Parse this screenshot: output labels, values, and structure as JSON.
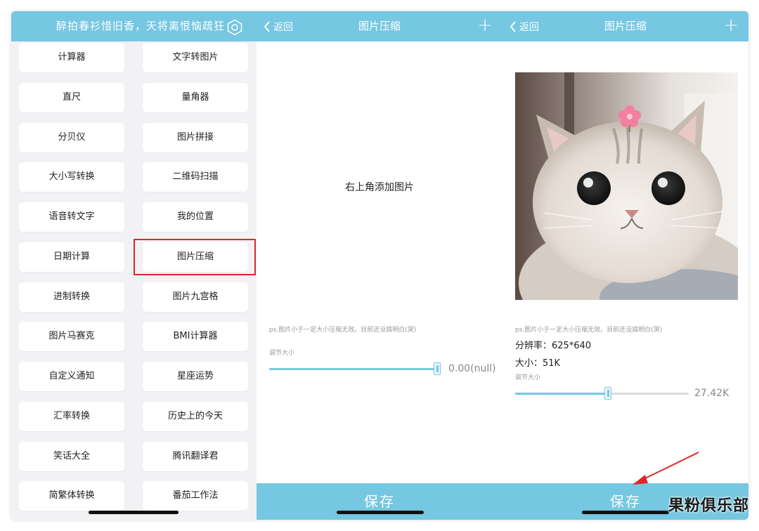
{
  "panel1": {
    "header_title": "醉拍春衫惜旧香，天将离恨恼疏狂",
    "settings_icon": "hexagon-settings-icon",
    "tools": [
      [
        "计算器",
        "文字转图片"
      ],
      [
        "直尺",
        "量角器"
      ],
      [
        "分贝仪",
        "图片拼接"
      ],
      [
        "大小写转换",
        "二维码扫描"
      ],
      [
        "语音转文字",
        "我的位置"
      ],
      [
        "日期计算",
        "图片压缩"
      ],
      [
        "进制转换",
        "图片九宫格"
      ],
      [
        "图片马赛克",
        "BMI计算器"
      ],
      [
        "自定义通知",
        "星座运势"
      ],
      [
        "汇率转换",
        "历史上的今天"
      ],
      [
        "笑话大全",
        "腾讯翻译君"
      ],
      [
        "简繁体转换",
        "番茄工作法"
      ]
    ],
    "highlighted_tool": "图片压缩",
    "highlight_color": "#e0262b"
  },
  "panel2": {
    "back_label": "返回",
    "title": "图片压缩",
    "plus_label": "+",
    "empty_hint": "右上角添加图片",
    "note": "ps.图片小于一定大小压缩无效。目前还没搞明白(哭)",
    "slider_label": "调节大小",
    "slider_value": "0.00(null)",
    "slider_level": 1.0,
    "save_label": "保存"
  },
  "panel3": {
    "back_label": "返回",
    "title": "图片压缩",
    "plus_label": "+",
    "image_name": "cat-photo",
    "note": "ps.图片小于一定大小压缩无效。目前还没搞明白(哭)",
    "resolution_label": "分辨率：",
    "resolution_value": "625*640",
    "size_label": "大小：",
    "size_value": "51K",
    "slider_label": "调节大小",
    "slider_value": "27.42K",
    "slider_level": 0.54,
    "save_label": "保存"
  },
  "watermark": "果粉俱乐部",
  "colors": {
    "accent": "#76c7e1",
    "panel_bg": "#f2f2f4",
    "annotation_red": "#e0262b"
  }
}
